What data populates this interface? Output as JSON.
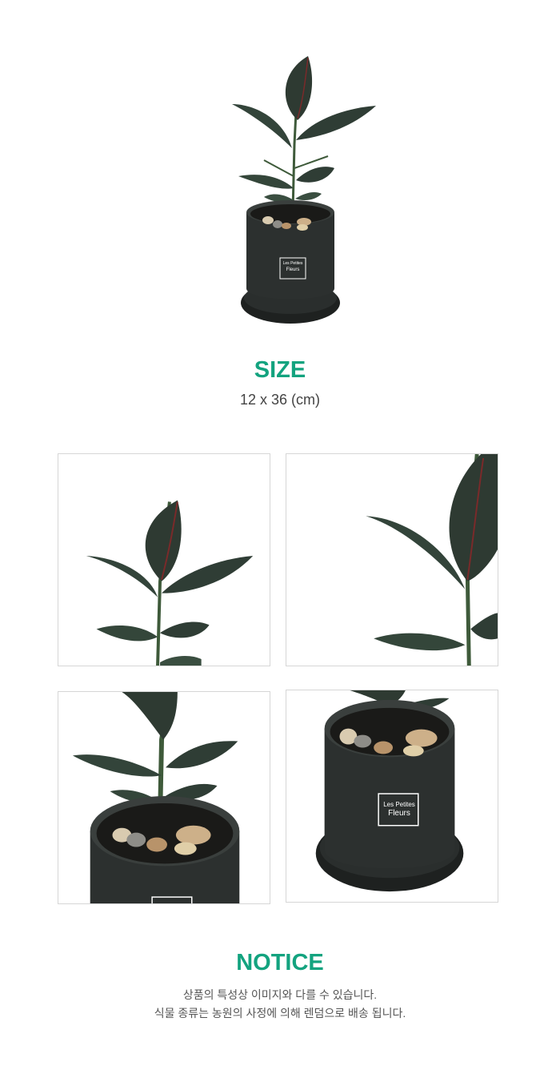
{
  "size": {
    "title": "SIZE",
    "value": "12 x 36 (cm)"
  },
  "brand_label": {
    "line1": "Les Petites",
    "line2": "Fleurs"
  },
  "notice": {
    "title": "NOTICE",
    "lines": [
      "상품의 특성상 이미지와 다를 수 있습니다.",
      "식물 종류는 농원의 사정에 의해 렌덤으로 배송 됩니다."
    ]
  },
  "colors": {
    "accent": "#13a37f",
    "pot": "#2c302f",
    "leaf": "#3a4a3c"
  },
  "gallery": [
    {
      "subject": "plant-leaves-closeup"
    },
    {
      "subject": "plant-leaf-detail"
    },
    {
      "subject": "plant-in-pot-top"
    },
    {
      "subject": "pot-with-label"
    }
  ]
}
